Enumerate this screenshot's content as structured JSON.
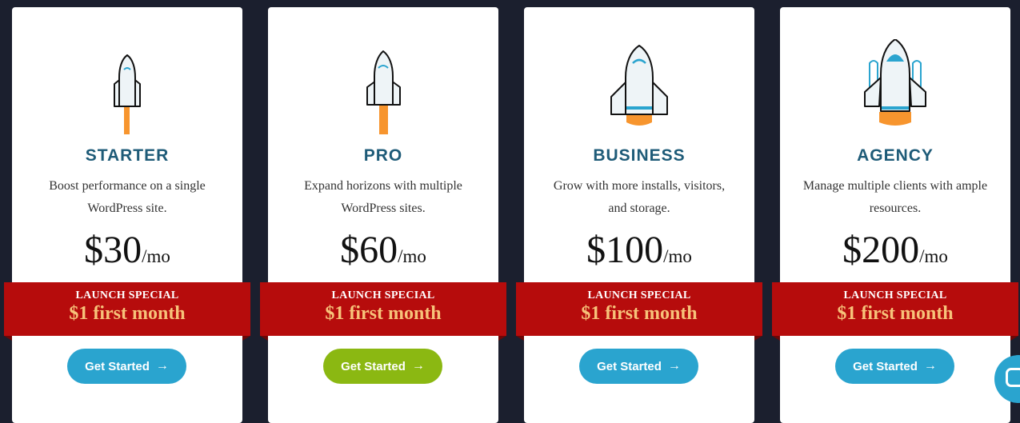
{
  "colors": {
    "background": "#1b1f2e",
    "card": "#ffffff",
    "plan_title": "#1e5b78",
    "ribbon": "#b60c0c",
    "ribbon_offer_text": "#f7c37a",
    "button_blue": "#2aa4cf",
    "button_green": "#8bb812",
    "rocket_flame": "#f7952e",
    "rocket_accent": "#2aa4cf"
  },
  "plans": [
    {
      "icon": "rocket-small-icon",
      "name": "STARTER",
      "description": "Boost performance on a single WordPress site.",
      "price": "$30",
      "period": "/mo",
      "ribbon_label": "LAUNCH SPECIAL",
      "ribbon_offer": "$1 first month",
      "cta_label": "Get Started",
      "cta_color": "#2aa4cf"
    },
    {
      "icon": "rocket-medium-icon",
      "name": "PRO",
      "description": "Expand horizons with multiple WordPress sites.",
      "price": "$60",
      "period": "/mo",
      "ribbon_label": "LAUNCH SPECIAL",
      "ribbon_offer": "$1 first month",
      "cta_label": "Get Started",
      "cta_color": "#8bb812"
    },
    {
      "icon": "rocket-large-icon",
      "name": "BUSINESS",
      "description": "Grow with more installs, visitors, and storage.",
      "price": "$100",
      "period": "/mo",
      "ribbon_label": "LAUNCH SPECIAL",
      "ribbon_offer": "$1 first month",
      "cta_label": "Get Started",
      "cta_color": "#2aa4cf"
    },
    {
      "icon": "rocket-boosters-icon",
      "name": "AGENCY",
      "description": "Manage multiple clients with ample resources.",
      "price": "$200",
      "period": "/mo",
      "ribbon_label": "LAUNCH SPECIAL",
      "ribbon_offer": "$1 first month",
      "cta_label": "Get Started",
      "cta_color": "#2aa4cf"
    }
  ],
  "chat": {
    "icon": "chat-icon"
  }
}
